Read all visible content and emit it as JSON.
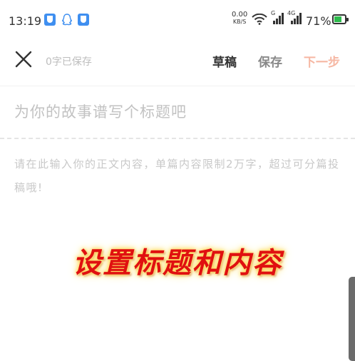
{
  "status_bar": {
    "time": "13:19",
    "net_speed_value": "0.00",
    "net_speed_unit": "KB/S",
    "signal_1_label": "G",
    "signal_2_label": "4G",
    "battery_percent": "71%",
    "battery_level": 0.71
  },
  "toolbar": {
    "close_icon": "close-x-icon",
    "saved_status": "0字已保存",
    "draft_label": "草稿",
    "save_label": "保存",
    "next_label": "下一步"
  },
  "editor": {
    "title_placeholder": "为你的故事谱写个标题吧",
    "content_placeholder": "请在此输入你的正文内容，单篇内容限制2万字，超过可分篇投稿哦!"
  },
  "overlay": {
    "caption": "设置标题和内容"
  },
  "colors": {
    "accent_next": "#f6b7a3",
    "caption_red": "#e01010",
    "shield_blue": "#3f8ff0",
    "battery_green": "#2dbb4c"
  }
}
